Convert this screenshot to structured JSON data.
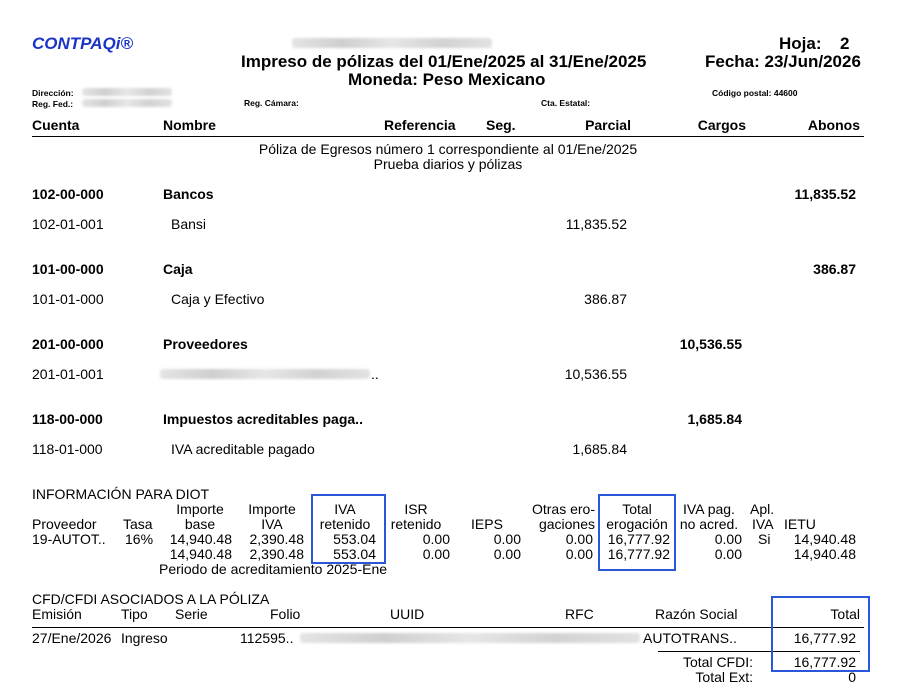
{
  "header": {
    "logo": "CONTPAQi®",
    "title": "Impreso de pólizas del 01/Ene/2025 al 31/Ene/2025",
    "currency": "Moneda: Peso Mexicano",
    "sheet_label": "Hoja:",
    "sheet_value": "2",
    "date": "Fecha: 23/Jun/2026",
    "address_label": "Dirección:",
    "reg_fed_label": "Reg. Fed.:",
    "reg_camara_label": "Reg. Cámara:",
    "cta_estatal_label": "Cta. Estatal:",
    "postal_code": "Código postal: 44600"
  },
  "columns": {
    "cuenta": "Cuenta",
    "nombre": "Nombre",
    "referencia": "Referencia",
    "seg": "Seg.",
    "parcial": "Parcial",
    "cargos": "Cargos",
    "abonos": "Abonos"
  },
  "poliza": {
    "description": "Póliza de Egresos número 1 correspondiente al 01/Ene/2025",
    "concept": "Prueba diarios y pólizas"
  },
  "entries": [
    {
      "account": "102-00-000",
      "name": "Bancos",
      "cargos": "",
      "abonos": "11,835.52"
    },
    {
      "account": "102-01-001",
      "name": "Bansi",
      "parcial": "11,835.52"
    },
    {
      "account": "101-00-000",
      "name": "Caja",
      "cargos": "",
      "abonos": "386.87"
    },
    {
      "account": "101-01-000",
      "name": "Caja y Efectivo",
      "parcial": "386.87"
    },
    {
      "account": "201-00-000",
      "name": "Proveedores",
      "cargos": "10,536.55",
      "abonos": ""
    },
    {
      "account": "201-01-001",
      "name": "..",
      "parcial": "10,536.55"
    },
    {
      "account": "118-00-000",
      "name": "Impuestos acreditables paga..",
      "cargos": "1,685.84",
      "abonos": ""
    },
    {
      "account": "118-01-000",
      "name": "IVA acreditable pagado",
      "parcial": "1,685.84"
    }
  ],
  "diot": {
    "title": "INFORMACIÓN PARA DIOT",
    "headers": {
      "proveedor": "Proveedor",
      "tasa": "Tasa",
      "importe_base_1": "Importe",
      "importe_base_2": "base",
      "importe_iva_1": "Importe",
      "importe_iva_2": "IVA",
      "iva_ret_1": "IVA",
      "iva_ret_2": "retenido",
      "isr_ret_1": "ISR",
      "isr_ret_2": "retenido",
      "ieps": "IEPS",
      "otras_1": "Otras ero-",
      "otras_2": "gaciones",
      "total_1": "Total",
      "total_2": "erogación",
      "iva_pag_1": "IVA pag.",
      "iva_pag_2": "no acred.",
      "apl_1": "Apl.",
      "apl_2": "IVA",
      "ietu": "IETU"
    },
    "rows": [
      {
        "proveedor": "19-AUTOT..",
        "tasa": "16%",
        "base": "14,940.48",
        "iva": "2,390.48",
        "iva_ret": "553.04",
        "isr_ret": "0.00",
        "ieps": "0.00",
        "otras": "0.00",
        "total": "16,777.92",
        "iva_pag": "0.00",
        "apl": "Si",
        "ietu": "14,940.48"
      },
      {
        "proveedor": "",
        "tasa": "",
        "base": "14,940.48",
        "iva": "2,390.48",
        "iva_ret": "553.04",
        "isr_ret": "0.00",
        "ieps": "0.00",
        "otras": "0.00",
        "total": "16,777.92",
        "iva_pag": "0.00",
        "apl": "",
        "ietu": "14,940.48"
      }
    ],
    "period": "Periodo de acreditamiento 2025-Ene"
  },
  "cfdi": {
    "title": "CFD/CFDI ASOCIADOS A LA PÓLIZA",
    "headers": {
      "emision": "Emisión",
      "tipo": "Tipo",
      "serie": "Serie",
      "folio": "Folio",
      "uuid": "UUID",
      "rfc": "RFC",
      "razon": "Razón Social",
      "total": "Total"
    },
    "row": {
      "emision": "27/Ene/2026",
      "tipo": "Ingreso",
      "folio": "112595..",
      "razon": "AUTOTRANS..",
      "total": "16,777.92"
    },
    "total_cfdi_label": "Total CFDI:",
    "total_cfdi_value": "16,777.92",
    "total_ext_label": "Total Ext:",
    "total_ext_value": "0"
  },
  "highlight_color": "#2a56d9"
}
